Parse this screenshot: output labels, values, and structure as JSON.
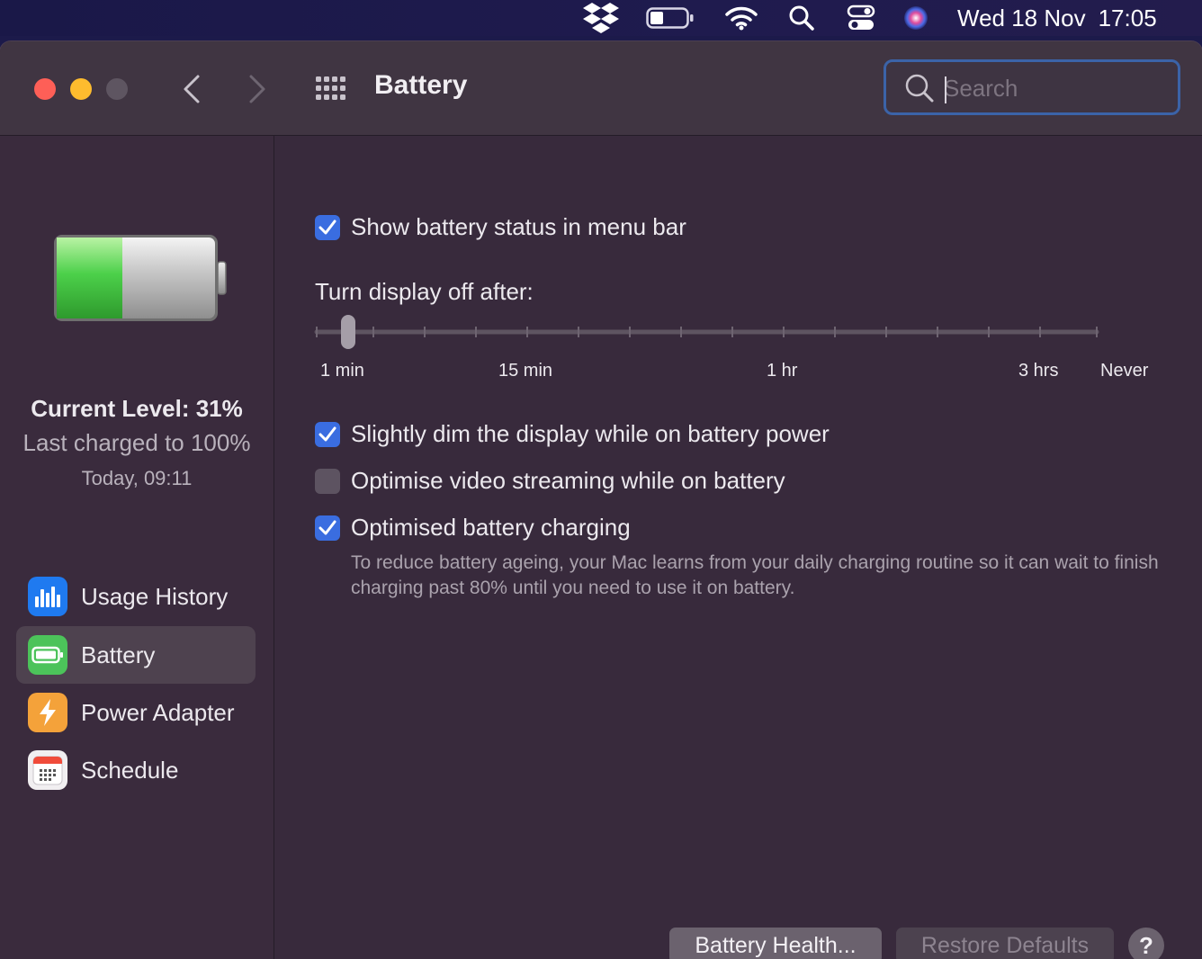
{
  "menubar": {
    "icons": [
      "dropbox-icon",
      "battery-icon",
      "wifi-icon",
      "spotlight-search-icon",
      "control-center-icon",
      "siri-icon"
    ],
    "date": "Wed 18 Nov",
    "time": "17:05"
  },
  "window": {
    "title": "Battery",
    "search": {
      "placeholder": "Search",
      "value": ""
    }
  },
  "sidebar": {
    "battery_level": 0.31,
    "current_level": "Current Level: 31%",
    "last_charged": "Last charged to 100%",
    "last_charged_time": "Today, 09:11",
    "items": [
      {
        "label": "Usage History",
        "icon": "usage-history-icon",
        "color": "#1f7af0",
        "active": false
      },
      {
        "label": "Battery",
        "icon": "battery-pane-icon",
        "color": "#4cc35a",
        "active": true
      },
      {
        "label": "Power Adapter",
        "icon": "power-adapter-icon",
        "color": "#f4a23a",
        "active": false
      },
      {
        "label": "Schedule",
        "icon": "schedule-icon",
        "color": "#f1eff1",
        "active": false
      }
    ]
  },
  "settings": {
    "show_status": {
      "label": "Show battery status in menu bar",
      "checked": true
    },
    "display_off": {
      "label": "Turn display off after:",
      "tick_labels": [
        "1 min",
        "15 min",
        "1 hr",
        "3 hrs",
        "Never"
      ],
      "value": "2 min"
    },
    "dim_display": {
      "label": "Slightly dim the display while on battery power",
      "checked": true
    },
    "optimise_video": {
      "label": "Optimise video streaming while on battery",
      "checked": false
    },
    "optimised_charging": {
      "label": "Optimised battery charging",
      "checked": true,
      "description": "To reduce battery ageing, your Mac learns from your daily charging routine so it can wait to finish charging past 80% until you need to use it on battery."
    }
  },
  "buttons": {
    "battery_health": "Battery Health...",
    "restore_defaults": "Restore Defaults",
    "help": "?"
  },
  "colors": {
    "accent": "#3a6de0",
    "battery_green": "#4cd04a"
  }
}
